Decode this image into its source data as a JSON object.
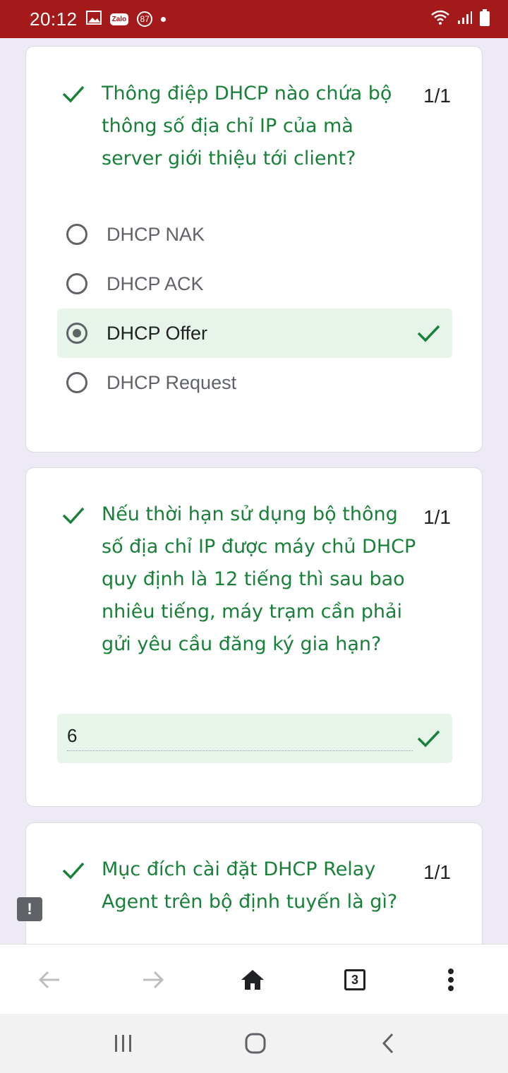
{
  "status": {
    "time": "20:12",
    "zalo_label": "Zalo",
    "notif_count": "87"
  },
  "questions": [
    {
      "text": "Thông điệp DHCP nào chứa bộ thông số địa chỉ IP của mà server giới thiệu tới client?",
      "score": "1/1",
      "options": [
        {
          "label": "DHCP NAK",
          "selected": false
        },
        {
          "label": "DHCP ACK",
          "selected": false
        },
        {
          "label": "DHCP Offer",
          "selected": true
        },
        {
          "label": "DHCP Request",
          "selected": false
        }
      ]
    },
    {
      "text": "Nếu thời hạn sử dụng bộ thông số địa chỉ IP được máy chủ DHCP quy định là 12 tiếng thì sau bao nhiêu tiếng, máy trạm cần phải gửi yêu cầu đăng ký gia hạn?",
      "score": "1/1",
      "answer": "6"
    },
    {
      "text": "Mục đích cài đặt DHCP Relay Agent trên bộ định tuyến là gì?",
      "score": "1/1"
    }
  ],
  "feedback_label": "!",
  "browser": {
    "tab_count": "3"
  },
  "colors": {
    "status_bar": "#a4191a",
    "correct_green": "#188038",
    "correct_bg": "#e6f4ea",
    "page_bg": "#ede9f5"
  }
}
